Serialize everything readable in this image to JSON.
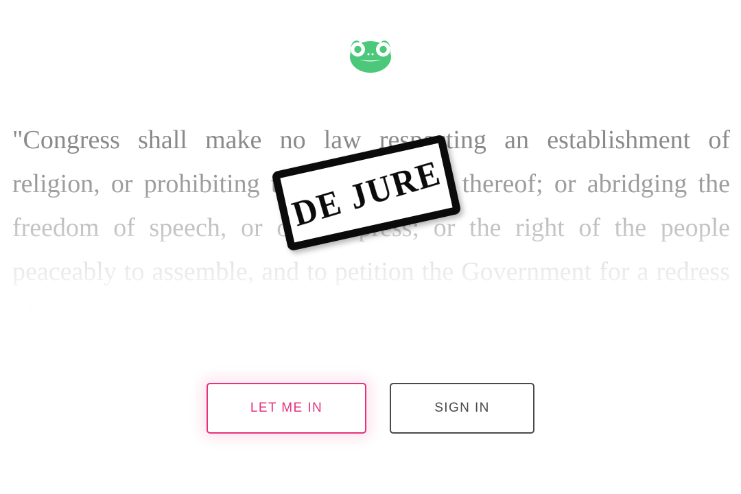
{
  "page": {
    "background": "#ffffff"
  },
  "logo": {
    "name": "frog-logo",
    "color": "#4cc87a",
    "eye_color": "#ffffff"
  },
  "quote": {
    "text": "\"Congress shall make no law respecting an establishment of religion, or prohibiting the free exercise thereof; or abridging the freedom of speech, or of the press; or the right of the people peaceably to assemble, and to petition the Government for a redress of grievances.\"",
    "color": "#8a8a8a"
  },
  "stamp": {
    "label": "DE JURE",
    "border_color": "#0b0b0b",
    "fill_color": "#ffffff",
    "rotation_degrees": -12.5
  },
  "buttons": {
    "primary": {
      "label": "LET ME IN",
      "color": "#e5317e",
      "border_color": "#e5317e"
    },
    "secondary": {
      "label": "SIGN IN",
      "color": "#4a4a4a",
      "border_color": "#4a4a4a"
    }
  }
}
